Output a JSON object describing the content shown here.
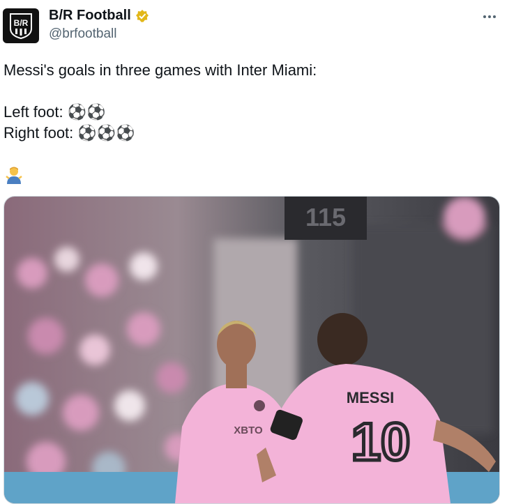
{
  "author": {
    "display_name": "B/R Football",
    "handle": "@brfootball",
    "avatar_text": "B/R",
    "verified_icon": "verified-badge-icon"
  },
  "more_icon": "more-options-icon",
  "tweet": {
    "text": "Messi's goals in three games with Inter Miami:\n\nLeft foot: ⚽⚽\nRight foot: ⚽⚽⚽",
    "trailing_emoji": "person-shrugging-emoji"
  },
  "media": {
    "scoreboard_text": "115",
    "jersey_name": "MESSI",
    "jersey_number": "10",
    "sponsor_text": "XBTO",
    "colors": {
      "jersey_pink": "#f3b3d8",
      "stadium_dark": "#2a2a2e",
      "crowd_pink": "#d89bbd"
    }
  }
}
